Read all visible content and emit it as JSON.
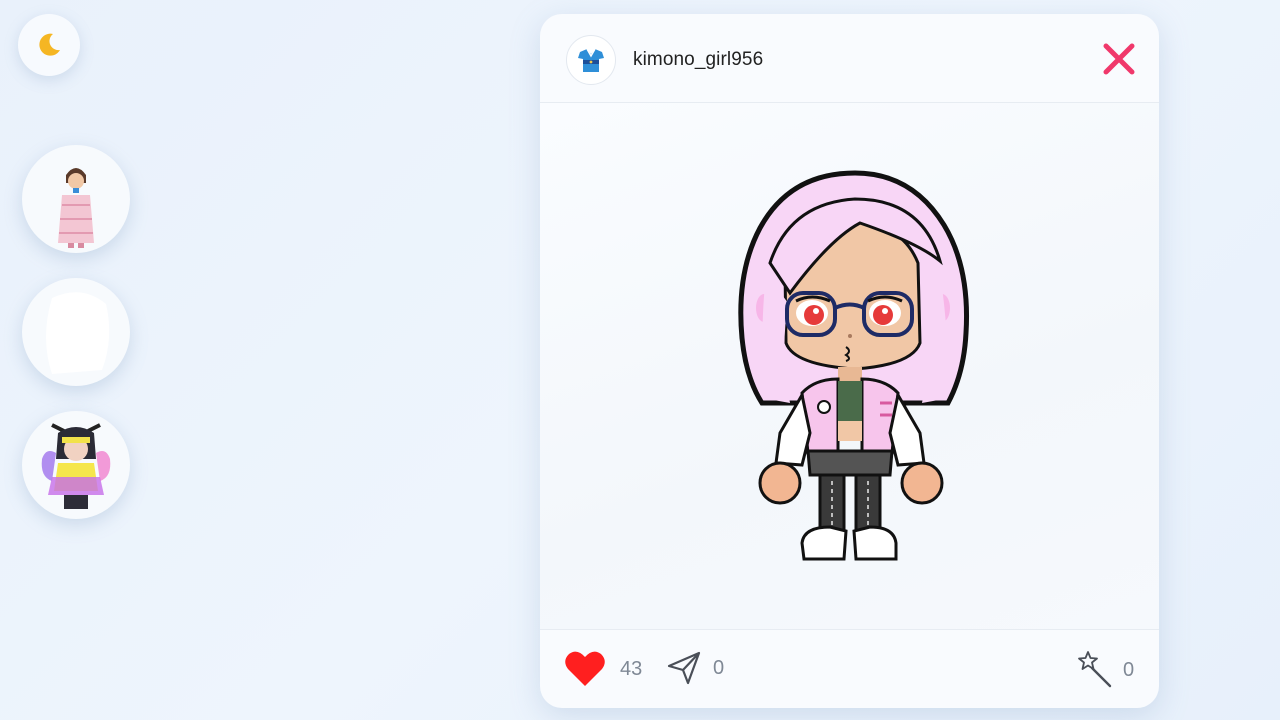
{
  "sidebar": {
    "theme_toggle": {
      "icon": "moon-icon"
    },
    "avatars": [
      {
        "name": "avatar-thumb-1"
      },
      {
        "name": "avatar-thumb-2"
      },
      {
        "name": "avatar-thumb-3"
      }
    ]
  },
  "post": {
    "username": "kimono_girl956",
    "user_icon": "kimono-icon",
    "likes": "43",
    "shares": "0",
    "magic": "0",
    "colors": {
      "like": "#ff1f1f",
      "close": "#f0386b"
    }
  }
}
